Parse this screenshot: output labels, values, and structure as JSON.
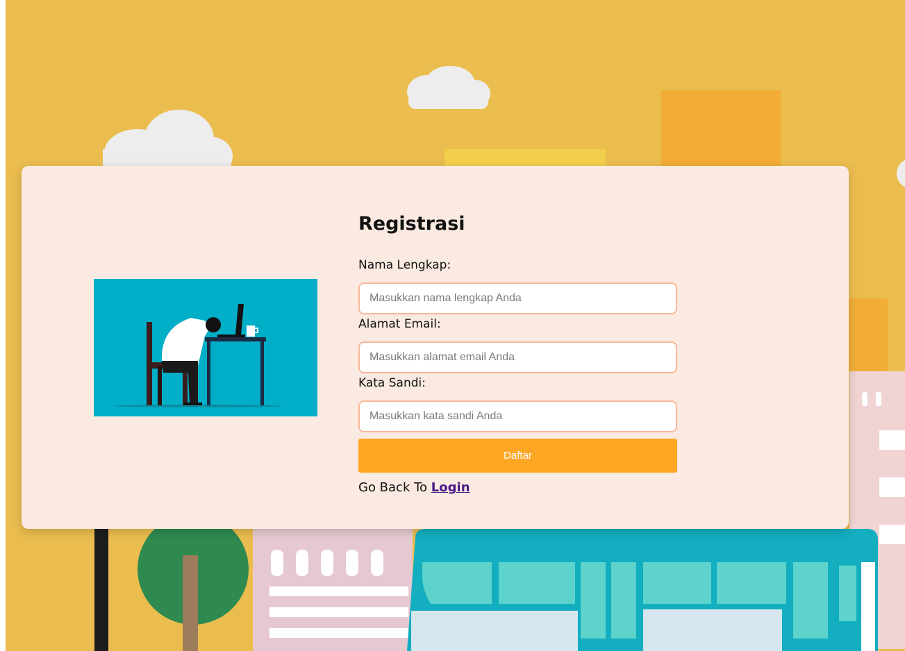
{
  "form": {
    "title": "Registrasi",
    "name_label": "Nama Lengkap:",
    "name_placeholder": "Masukkan nama lengkap Anda",
    "email_label": "Alamat Email:",
    "email_placeholder": "Masukkan alamat email Anda",
    "password_label": "Kata Sandi:",
    "password_placeholder": "Masukkan kata sandi Anda",
    "submit_label": "Daftar",
    "back_text": "Go Back To",
    "login_link": "Login"
  },
  "colors": {
    "background": "#ebbd4f",
    "card": "#fbeae1",
    "input_border": "#f7b89a",
    "button": "#fca624",
    "link": "#4a1a86",
    "illustration_bg": "#00aec8"
  },
  "icons": {
    "illustration": "tired-worker-at-desk-illustration"
  }
}
